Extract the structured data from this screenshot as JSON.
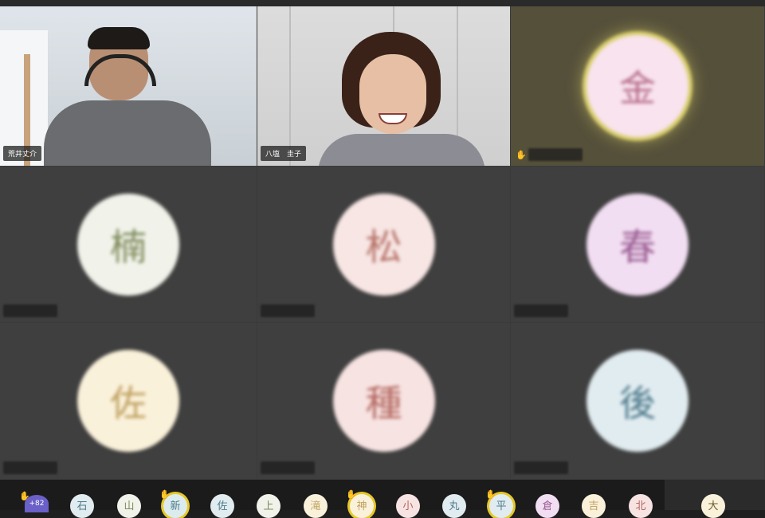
{
  "tiles": [
    {
      "type": "video",
      "name": "荒井丈介"
    },
    {
      "type": "video",
      "name": "八塩　圭子"
    },
    {
      "type": "avatar",
      "initial": "金",
      "bg": "#f8e3ee",
      "fg": "#b86d8c",
      "tile": "olive",
      "ring": true,
      "hand": true
    },
    {
      "type": "avatar",
      "initial": "楠",
      "bg": "#f1f3ea",
      "fg": "#7c8a5a",
      "tile": "gray"
    },
    {
      "type": "avatar",
      "initial": "松",
      "bg": "#f7e6e4",
      "fg": "#b77268",
      "tile": "gray"
    },
    {
      "type": "avatar",
      "initial": "春",
      "bg": "#f2def2",
      "fg": "#9a5c93",
      "tile": "gray"
    },
    {
      "type": "avatar",
      "initial": "佐",
      "bg": "#faf1da",
      "fg": "#bfa060",
      "tile": "gray"
    },
    {
      "type": "avatar",
      "initial": "種",
      "bg": "#f7e3e2",
      "fg": "#b4675f",
      "tile": "gray"
    },
    {
      "type": "avatar",
      "initial": "後",
      "bg": "#e1ecf0",
      "fg": "#4d7a8c",
      "tile": "gray"
    }
  ],
  "participants_strip": {
    "more_count": "+82",
    "chips": [
      {
        "initial": "石",
        "bg": "#e1ecf0",
        "fg": "#4d7a8c"
      },
      {
        "initial": "山",
        "bg": "#f1f3ea",
        "fg": "#7c8a5a"
      },
      {
        "initial": "新",
        "bg": "#dcecee",
        "fg": "#4d7a8c",
        "ring": true,
        "hand": true
      },
      {
        "initial": "佐",
        "bg": "#e1ecf0",
        "fg": "#4d7a8c"
      },
      {
        "initial": "上",
        "bg": "#f1f3ea",
        "fg": "#7c8a5a"
      },
      {
        "initial": "滝",
        "bg": "#faf1da",
        "fg": "#bfa060"
      },
      {
        "initial": "神",
        "bg": "#faf1da",
        "fg": "#bfa060",
        "ring": true,
        "hand": true
      },
      {
        "initial": "小",
        "bg": "#f7e3e2",
        "fg": "#b4675f"
      },
      {
        "initial": "丸",
        "bg": "#e1ecf0",
        "fg": "#4d7a8c"
      },
      {
        "initial": "平",
        "bg": "#e1ecf0",
        "fg": "#4d7a8c",
        "ring": true,
        "hand": true
      },
      {
        "initial": "倉",
        "bg": "#f2def2",
        "fg": "#9a5c93"
      },
      {
        "initial": "吉",
        "bg": "#faf1da",
        "fg": "#bfa060"
      },
      {
        "initial": "北",
        "bg": "#f7e3e2",
        "fg": "#b4675f"
      }
    ],
    "right_chip": {
      "initial": "大",
      "bg": "#faf1da",
      "fg": "#6b5a2a"
    }
  },
  "icons": {
    "raise_hand": "raised-hand-icon"
  }
}
